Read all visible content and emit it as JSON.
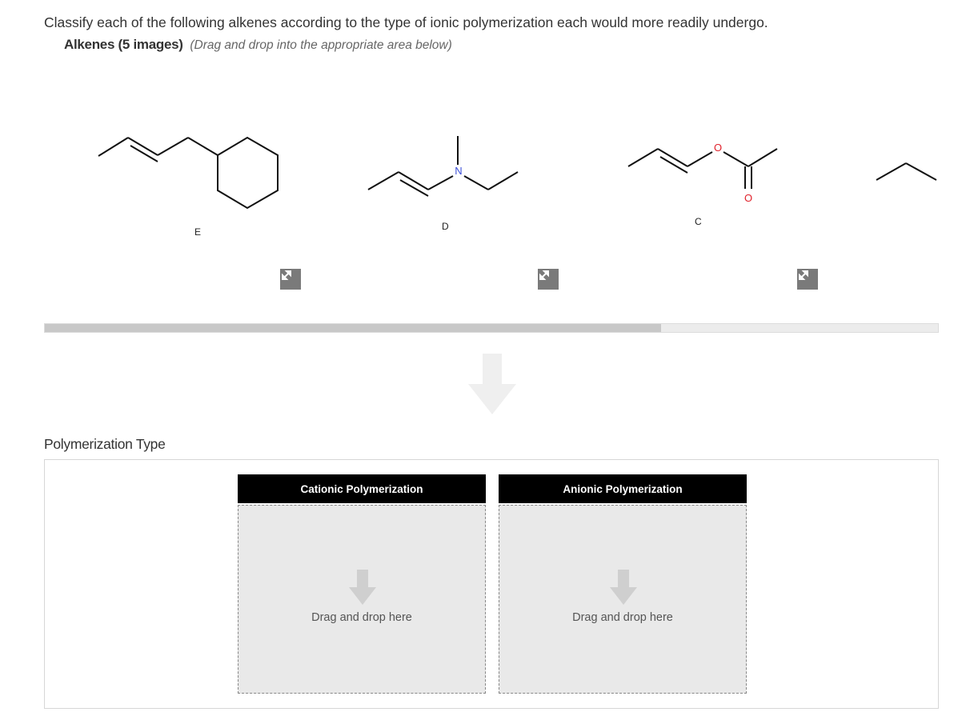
{
  "question": "Classify each of the following alkenes according to the type of ionic polymerization each would more readily undergo.",
  "alkenes": {
    "title": "Alkenes (5 images)",
    "hint": "(Drag and drop into the appropriate area below)",
    "items": [
      {
        "label": "E"
      },
      {
        "label": "D"
      },
      {
        "label": "C"
      }
    ]
  },
  "atoms": {
    "nitrogen": "N",
    "oxygen": "O"
  },
  "scroll_progress_percent": 69,
  "polymerization": {
    "title": "Polymerization Type",
    "bins": [
      {
        "label": "Cationic Polymerization",
        "placeholder": "Drag and drop here"
      },
      {
        "label": "Anionic Polymerization",
        "placeholder": "Drag and drop here"
      }
    ]
  },
  "colors": {
    "bin_header": "#000000",
    "drop_zone": "#e9e9e9",
    "oxygen": "#e0202a",
    "nitrogen": "#3b4fd8"
  },
  "icons": [
    "expand-icon",
    "down-arrow-icon"
  ]
}
